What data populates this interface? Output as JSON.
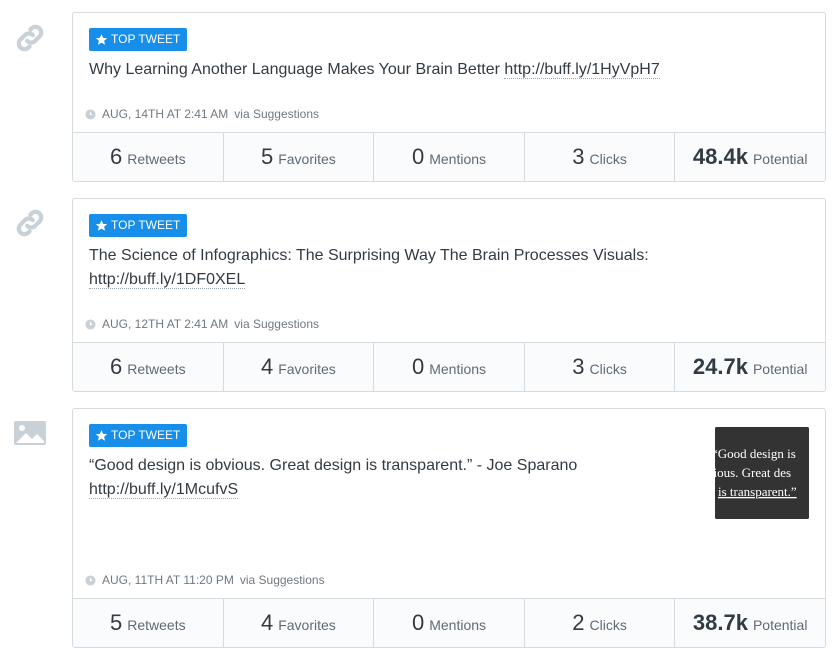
{
  "posts": [
    {
      "type_icon": "link-icon",
      "badge": "TOP TWEET",
      "text": "Why Learning Another Language Makes Your Brain Better ",
      "link": "http://buff.ly/1HyVpH7",
      "date": "AUG, 14TH AT 2:41 AM",
      "via": "via Suggestions",
      "stats": {
        "retweets": "6",
        "retweets_label": "Retweets",
        "favorites": "5",
        "favorites_label": "Favorites",
        "mentions": "0",
        "mentions_label": "Mentions",
        "clicks": "3",
        "clicks_label": "Clicks",
        "potential": "48.4k",
        "potential_label": "Potential"
      }
    },
    {
      "type_icon": "link-icon",
      "badge": "TOP TWEET",
      "text": "The Science of Infographics: The Surprising Way The Brain Processes Visuals: ",
      "link": "http://buff.ly/1DF0XEL",
      "date": "AUG, 12TH AT 2:41 AM",
      "via": "via Suggestions",
      "stats": {
        "retweets": "6",
        "retweets_label": "Retweets",
        "favorites": "4",
        "favorites_label": "Favorites",
        "mentions": "0",
        "mentions_label": "Mentions",
        "clicks": "3",
        "clicks_label": "Clicks",
        "potential": "24.7k",
        "potential_label": "Potential"
      }
    },
    {
      "type_icon": "image-icon",
      "badge": "TOP TWEET",
      "text": "“Good design is obvious. Great design is transparent.” - Joe Sparano ",
      "link": "http://buff.ly/1McufvS",
      "thumbnail": {
        "line1": "“Good design is",
        "line2": "vious. Great des",
        "line3": "is transparent.”"
      },
      "date": "AUG, 11TH AT 11:20 PM",
      "via": "via Suggestions",
      "stats": {
        "retweets": "5",
        "retweets_label": "Retweets",
        "favorites": "4",
        "favorites_label": "Favorites",
        "mentions": "0",
        "mentions_label": "Mentions",
        "clicks": "2",
        "clicks_label": "Clicks",
        "potential": "38.7k",
        "potential_label": "Potential"
      }
    }
  ],
  "colors": {
    "badge": "#168eea",
    "border": "#d6dbe0",
    "icon_gray": "#c9d1d8"
  }
}
